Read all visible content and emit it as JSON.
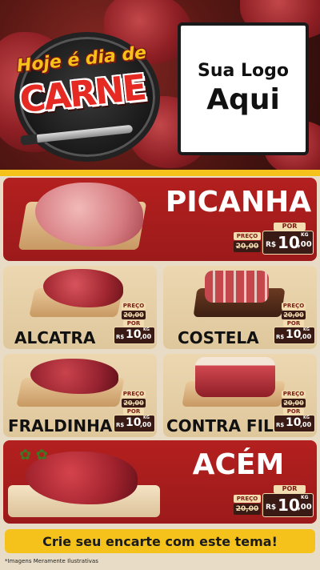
{
  "header": {
    "badge_line1": "Hoje é dia de",
    "badge_line2": "CARNE",
    "logo_line1": "Sua Logo",
    "logo_line2": "Aqui"
  },
  "price_labels": {
    "por": "POR",
    "preco": "PREÇO",
    "currency": "R$",
    "unit": "KG"
  },
  "products": [
    {
      "name": "PICANHA",
      "old_price": "20,00",
      "new_int": "10",
      "new_dec": ",00"
    },
    {
      "name": "ALCATRA",
      "old_price": "20,00",
      "new_int": "10",
      "new_dec": ",00"
    },
    {
      "name": "COSTELA",
      "old_price": "20,00",
      "new_int": "10",
      "new_dec": ",00"
    },
    {
      "name": "FRALDINHA",
      "old_price": "20,00",
      "new_int": "10",
      "new_dec": ",00"
    },
    {
      "name": "CONTRA FILÉ",
      "old_price": "20,00",
      "new_int": "10",
      "new_dec": ",00"
    },
    {
      "name": "ACÉM",
      "old_price": "20,00",
      "new_int": "10",
      "new_dec": ",00"
    }
  ],
  "footer": {
    "cta": "Crie seu encarte com este tema!",
    "note": "*Imagens Meramente Ilustrativas"
  },
  "colors": {
    "red": "#b01b1f",
    "yellow": "#f4c21a",
    "tan": "#ecd7b1",
    "dark": "#3a1a14"
  }
}
